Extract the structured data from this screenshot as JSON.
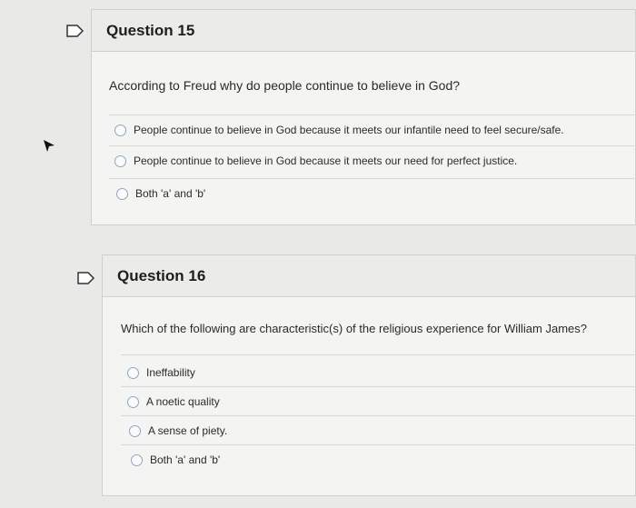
{
  "questions": [
    {
      "title": "Question 15",
      "prompt": "According to Freud why do people continue to believe in God?",
      "options": [
        "People continue to believe in God because it meets our infantile need to feel secure/safe.",
        "People continue to believe in God because it meets our need for perfect justice.",
        "Both 'a' and 'b'"
      ]
    },
    {
      "title": "Question 16",
      "prompt": "Which of the following are characteristic(s) of the religious experience for William James?",
      "options": [
        "Ineffability",
        "A noetic quality",
        "A sense of piety.",
        "Both 'a' and 'b'"
      ]
    }
  ],
  "icons": {
    "flag": "flag-icon",
    "radio": "radio-button",
    "cursor": "mouse-cursor-icon"
  }
}
